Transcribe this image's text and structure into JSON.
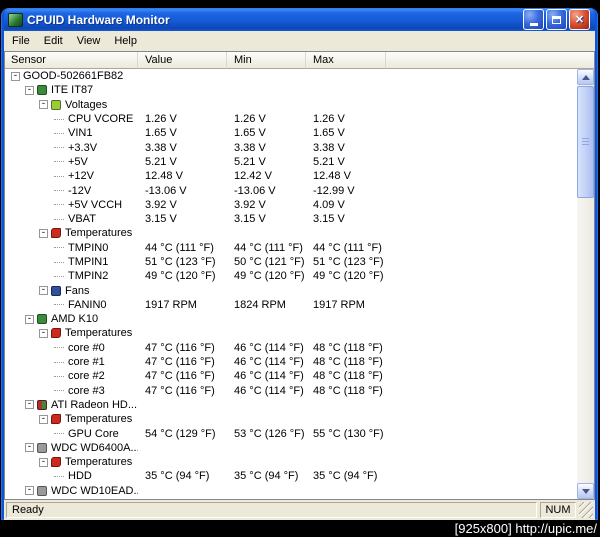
{
  "window": {
    "title": "CPUID Hardware Monitor"
  },
  "menu": {
    "items": [
      {
        "label": "File"
      },
      {
        "label": "Edit"
      },
      {
        "label": "View"
      },
      {
        "label": "Help"
      }
    ]
  },
  "columns": {
    "sensor": "Sensor",
    "value": "Value",
    "min": "Min",
    "max": "Max"
  },
  "tree": {
    "rows": [
      {
        "level": 0,
        "expand": true,
        "label": "GOOD-502661FB82"
      },
      {
        "level": 1,
        "expand": true,
        "type": "chip",
        "label": "ITE IT87"
      },
      {
        "level": 2,
        "expand": true,
        "type": "voltage",
        "label": "Voltages"
      },
      {
        "level": 3,
        "label": "CPU VCORE",
        "value": "1.26 V",
        "min": "1.26 V",
        "max": "1.26 V"
      },
      {
        "level": 3,
        "label": "VIN1",
        "value": "1.65 V",
        "min": "1.65 V",
        "max": "1.65 V"
      },
      {
        "level": 3,
        "label": "+3.3V",
        "value": "3.38 V",
        "min": "3.38 V",
        "max": "3.38 V"
      },
      {
        "level": 3,
        "label": "+5V",
        "value": "5.21 V",
        "min": "5.21 V",
        "max": "5.21 V"
      },
      {
        "level": 3,
        "label": "+12V",
        "value": "12.48 V",
        "min": "12.42 V",
        "max": "12.48 V"
      },
      {
        "level": 3,
        "label": "-12V",
        "value": "-13.06 V",
        "min": "-13.06 V",
        "max": "-12.99 V"
      },
      {
        "level": 3,
        "label": "+5V VCCH",
        "value": "3.92 V",
        "min": "3.92 V",
        "max": "4.09 V"
      },
      {
        "level": 3,
        "label": "VBAT",
        "value": "3.15 V",
        "min": "3.15 V",
        "max": "3.15 V"
      },
      {
        "level": 2,
        "expand": true,
        "type": "temperature",
        "label": "Temperatures"
      },
      {
        "level": 3,
        "label": "TMPIN0",
        "value": "44 °C (111 °F)",
        "min": "44 °C (111 °F)",
        "max": "44 °C (111 °F)"
      },
      {
        "level": 3,
        "label": "TMPIN1",
        "value": "51 °C (123 °F)",
        "min": "50 °C (121 °F)",
        "max": "51 °C (123 °F)"
      },
      {
        "level": 3,
        "label": "TMPIN2",
        "value": "49 °C (120 °F)",
        "min": "49 °C (120 °F)",
        "max": "49 °C (120 °F)"
      },
      {
        "level": 2,
        "expand": true,
        "type": "fan",
        "label": "Fans"
      },
      {
        "level": 3,
        "label": "FANIN0",
        "value": "1917 RPM",
        "min": "1824 RPM",
        "max": "1917 RPM"
      },
      {
        "level": 1,
        "expand": true,
        "type": "chip",
        "label": "AMD K10"
      },
      {
        "level": 2,
        "expand": true,
        "type": "temperature",
        "label": "Temperatures"
      },
      {
        "level": 3,
        "label": "core #0",
        "value": "47 °C (116 °F)",
        "min": "46 °C (114 °F)",
        "max": "48 °C (118 °F)"
      },
      {
        "level": 3,
        "label": "core #1",
        "value": "47 °C (116 °F)",
        "min": "46 °C (114 °F)",
        "max": "48 °C (118 °F)"
      },
      {
        "level": 3,
        "label": "core #2",
        "value": "47 °C (116 °F)",
        "min": "46 °C (114 °F)",
        "max": "48 °C (118 °F)"
      },
      {
        "level": 3,
        "label": "core #3",
        "value": "47 °C (116 °F)",
        "min": "46 °C (114 °F)",
        "max": "48 °C (118 °F)"
      },
      {
        "level": 1,
        "expand": true,
        "type": "gpu",
        "label": "ATI Radeon HD..."
      },
      {
        "level": 2,
        "expand": true,
        "type": "temperature",
        "label": "Temperatures"
      },
      {
        "level": 3,
        "label": "GPU Core",
        "value": "54 °C (129 °F)",
        "min": "53 °C (126 °F)",
        "max": "55 °C (130 °F)"
      },
      {
        "level": 1,
        "expand": true,
        "type": "disk",
        "label": "WDC WD6400A..."
      },
      {
        "level": 2,
        "expand": true,
        "type": "temperature",
        "label": "Temperatures"
      },
      {
        "level": 3,
        "label": "HDD",
        "value": "35 °C (94 °F)",
        "min": "35 °C (94 °F)",
        "max": "35 °C (94 °F)"
      },
      {
        "level": 1,
        "expand": true,
        "type": "disk",
        "label": "WDC WD10EAD..."
      }
    ]
  },
  "statusbar": {
    "ready": "Ready",
    "num": "NUM"
  },
  "watermark": "[925x800] http://upic.me/"
}
